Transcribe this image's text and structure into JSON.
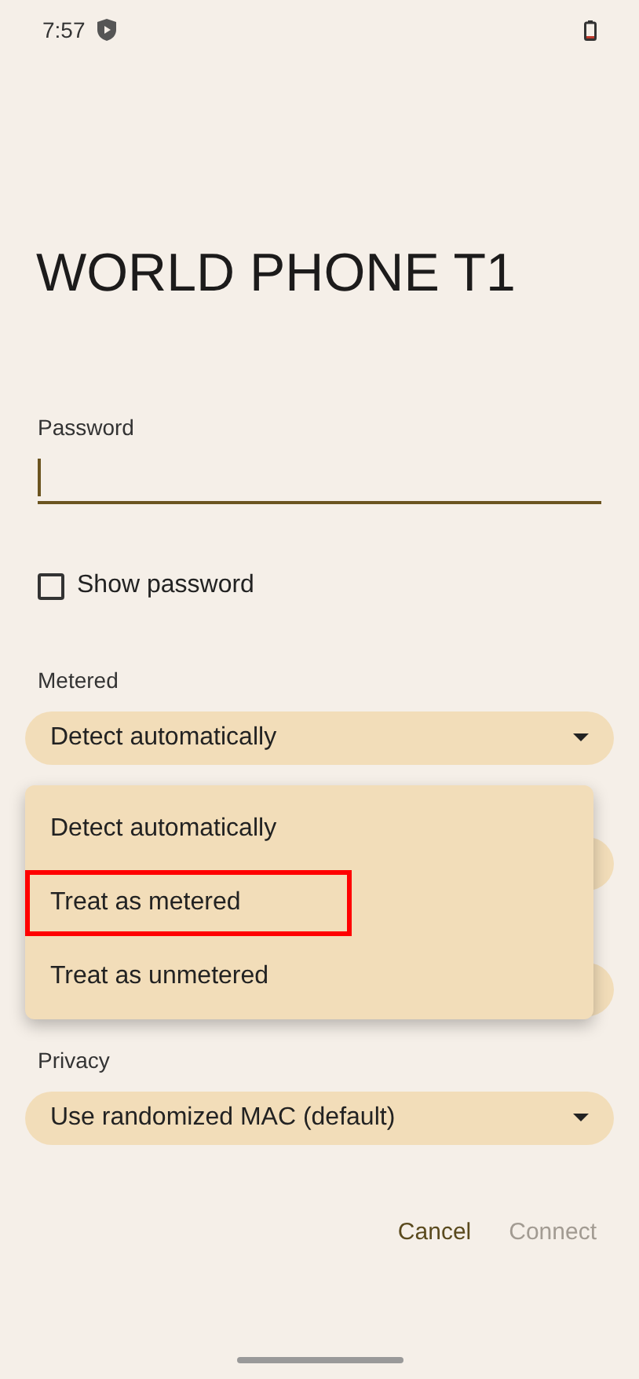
{
  "status_bar": {
    "time": "7:57"
  },
  "title": "WORLD PHONE T1",
  "password": {
    "label": "Password",
    "focused": true
  },
  "show_password": {
    "label": "Show password",
    "checked": false
  },
  "metered": {
    "label": "Metered",
    "value": "Detect automatically"
  },
  "menu": {
    "items": [
      {
        "label": "Detect automatically",
        "highlighted": false
      },
      {
        "label": "Treat as metered",
        "highlighted": true
      },
      {
        "label": "Treat as unmetered",
        "highlighted": false
      }
    ]
  },
  "privacy": {
    "label": "Privacy",
    "value": "Use randomized MAC (default)"
  },
  "buttons": [
    {
      "label": "Cancel",
      "disabled": false
    },
    {
      "label": "Connect",
      "disabled": true
    }
  ]
}
